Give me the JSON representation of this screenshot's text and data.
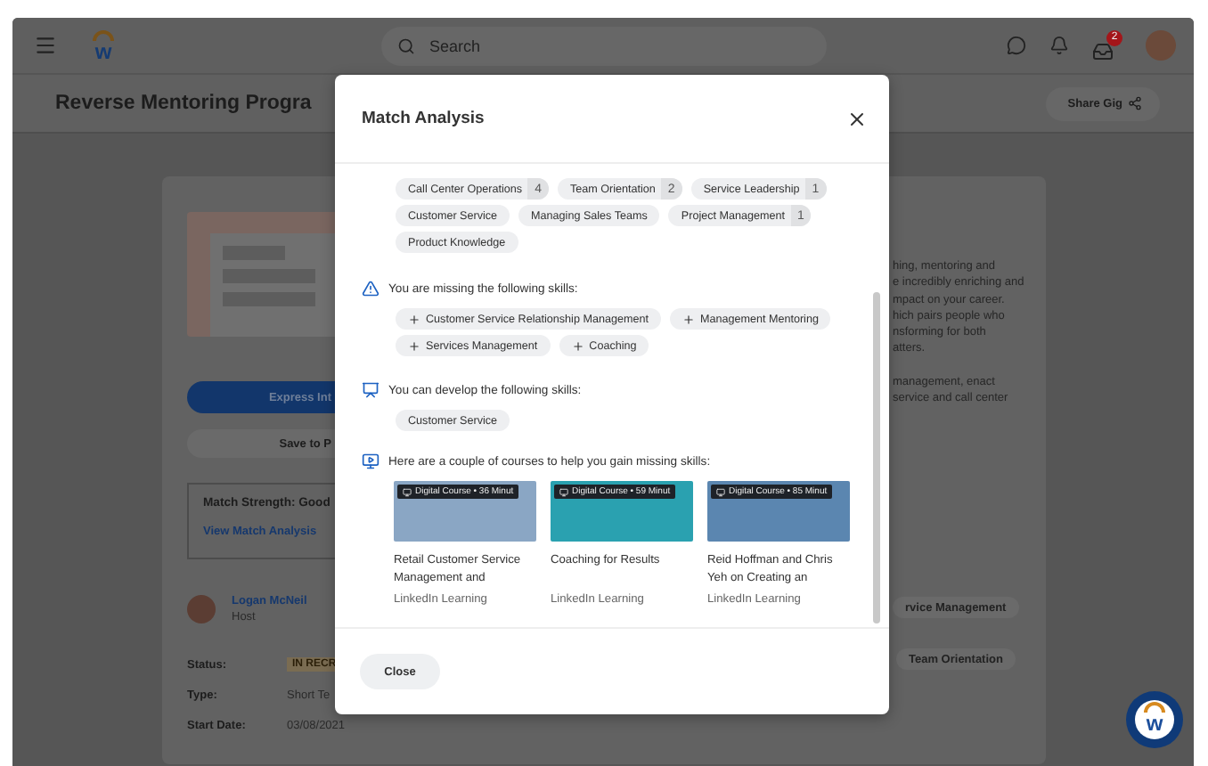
{
  "top_bar": {
    "logo_letter": "w",
    "search": {
      "placeholder": "Search"
    },
    "inbox_badge": "2"
  },
  "title_bar": {
    "title": "Reverse Mentoring Progra",
    "share_button": "Share Gig"
  },
  "gig_card": {
    "express_button": "Express Int",
    "save_button": "Save to P",
    "match_strength": "Match Strength: Good",
    "match_link": "View Match Analysis",
    "host": {
      "name": "Logan McNeil",
      "role": "Host"
    },
    "details": [
      {
        "label": "Status:",
        "value": "IN RECR",
        "kind": "tag"
      },
      {
        "label": "Type:",
        "value": "Short Te",
        "kind": "text"
      },
      {
        "label": "Start Date:",
        "value": "03/08/2021",
        "kind": "text"
      }
    ],
    "description": [
      [
        "hing, mentoring and",
        "e incredibly enriching and",
        "mpact on your career.",
        "hich pairs people who",
        "nsforming for both",
        "atters."
      ],
      [
        "management, enact",
        "service and call center"
      ]
    ],
    "skill_chips": [
      "rvice Management",
      "Team Orientation"
    ]
  },
  "modal": {
    "title": "Match Analysis",
    "matched_skills": [
      {
        "label": "Call Center Operations",
        "count": "4"
      },
      {
        "label": "Team Orientation",
        "count": "2"
      },
      {
        "label": "Service Leadership",
        "count": "1"
      },
      {
        "label": "Customer Service"
      },
      {
        "label": "Managing Sales Teams"
      },
      {
        "label": "Project Management",
        "count": "1"
      },
      {
        "label": "Product Knowledge"
      }
    ],
    "missing": {
      "heading": "You are missing the following skills:",
      "skills": [
        "Customer Service Relationship Management",
        "Management Mentoring",
        "Services Management",
        "Coaching"
      ]
    },
    "develop": {
      "heading": "You can develop the following skills:",
      "skills": [
        "Customer Service"
      ]
    },
    "courses": {
      "heading": "Here are a couple of courses to help you gain missing skills:",
      "items": [
        {
          "badge": "Digital Course • 36 Minut",
          "title": "Retail Customer Service Management and",
          "provider": "LinkedIn Learning"
        },
        {
          "badge": "Digital Course • 59 Minut",
          "title": "Coaching for Results",
          "provider": "LinkedIn Learning"
        },
        {
          "badge": "Digital Course • 85 Minut",
          "title": "Reid Hoffman and Chris Yeh on Creating an",
          "provider": "LinkedIn Learning"
        }
      ]
    },
    "close_button": "Close"
  },
  "assistant": {
    "logo_letter": "w"
  }
}
